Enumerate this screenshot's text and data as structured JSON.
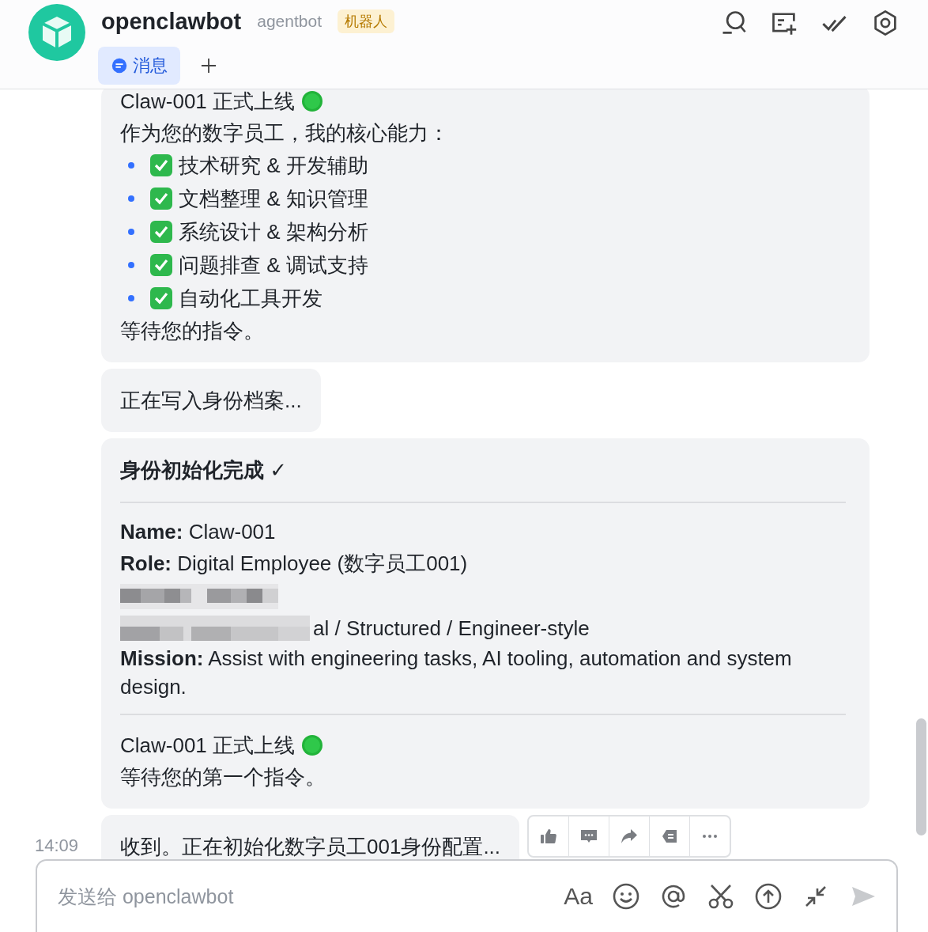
{
  "header": {
    "name": "openclawbot",
    "subtitle": "agentbot",
    "badge": "机器人"
  },
  "tabs": [
    {
      "label": "消息",
      "selected": true
    }
  ],
  "messages": [
    {
      "kind": "capabilities",
      "status": "Claw-001 正式上线",
      "intro": "作为您的数字员工，我的核心能力：",
      "items": [
        {
          "text": "技术研究 & 开发辅助",
          "checked": true
        },
        {
          "text": "文档整理 & 知识管理",
          "checked": true
        },
        {
          "text": "系统设计 & 架构分析",
          "checked": true
        },
        {
          "text": "问题排查 & 调试支持",
          "checked": true
        },
        {
          "text": "自动化工具开发",
          "checked": true
        }
      ],
      "footer": "等待您的指令。"
    },
    {
      "kind": "plain",
      "text": "正在写入身份档案..."
    },
    {
      "kind": "card",
      "title": "身份初始化完成 ✓",
      "fields": [
        {
          "kind": "field",
          "label": "Name:",
          "value": "Claw-001"
        },
        {
          "kind": "field",
          "label": "Role:",
          "value": "Digital Employee (数字员工001)"
        },
        {
          "kind": "redacted"
        },
        {
          "kind": "partly_redacted",
          "value": "al / Structured / Engineer-style"
        },
        {
          "kind": "field",
          "label": "Mission:",
          "value": "Assist with engineering tasks, AI tooling, automation and system design."
        }
      ],
      "status": "Claw-001 正式上线",
      "footer": "等待您的第一个指令。"
    },
    {
      "kind": "plain",
      "time": "14:09",
      "text": "收到。正在初始化数字员工001身份配置...",
      "show_actions": true
    }
  ],
  "composer": {
    "placeholder": "发送给 openclawbot",
    "format_label": "Aa"
  }
}
